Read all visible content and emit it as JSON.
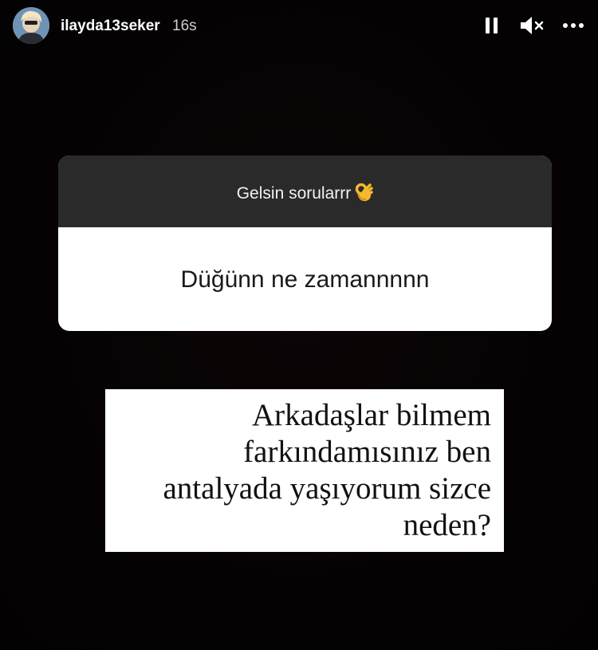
{
  "header": {
    "username": "ilayda13seker",
    "time": "16s"
  },
  "icons": {
    "avatar": "profile-photo",
    "pause": "pause-icon",
    "mute": "speaker-muted-icon",
    "more": "more-horizontal-icon",
    "emoji": "ok-hand-emoji"
  },
  "question_sticker": {
    "prompt": "Gelsin sorularrr",
    "answer": "Düğünn ne zamannnnn"
  },
  "note": {
    "lines": [
      "Arkadaşlar bilmem",
      "farkındamısınız ben",
      "antalyada yaşıyorum sizce",
      "neden?"
    ]
  },
  "colors": {
    "background": "#060203",
    "sticker_header": "#2a2a2a",
    "sticker_body": "#ffffff",
    "avatar": "#6f93b4"
  }
}
